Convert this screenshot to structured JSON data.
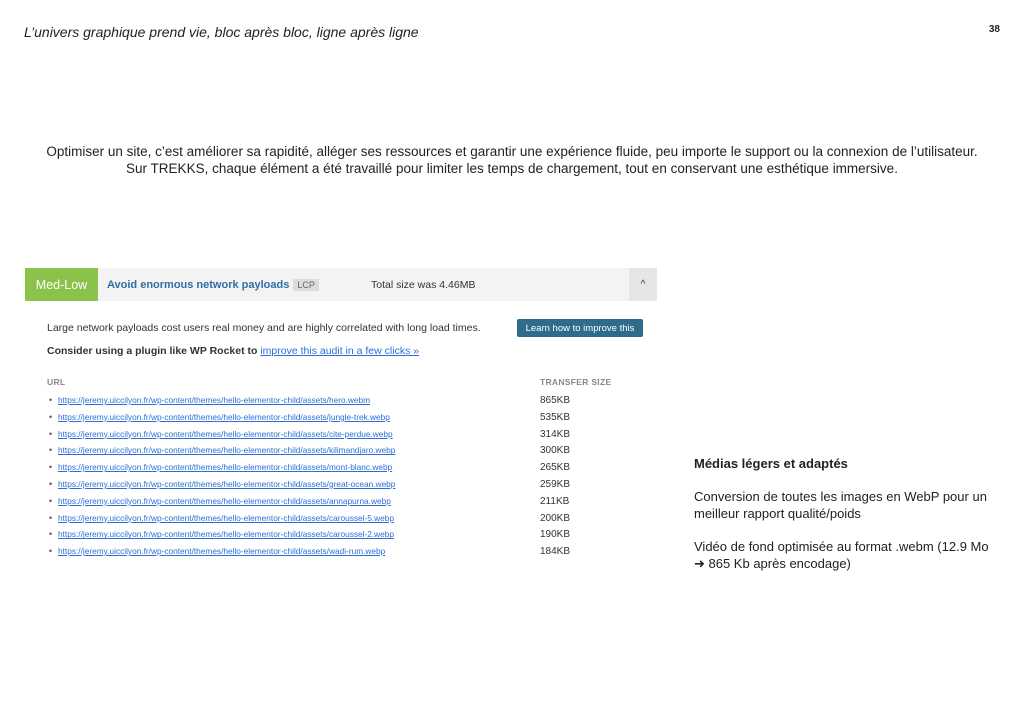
{
  "header": {
    "title": "L’univers graphique prend vie, bloc après bloc, ligne après ligne",
    "page_number": "38"
  },
  "intro": {
    "line1": "Optimiser un site, c’est améliorer sa rapidité, alléger ses ressources et garantir une expérience fluide, peu importe le support ou la connexion de l’utilisateur.",
    "line2": "Sur TREKKS, chaque élément a été travaillé pour limiter les temps de chargement, tout en conservant une esthétique immersive."
  },
  "audit": {
    "severity": "Med-Low",
    "title": "Avoid enormous network payloads",
    "tag": "LCP",
    "total_size": "Total size was 4.46MB",
    "toggle_icon": "chevron-up-icon",
    "toggle_glyph": "^",
    "description": "Large network payloads cost users real money and are highly correlated with long load times.",
    "learn_button": "Learn how to improve this",
    "plugin_prefix": "Consider using a plugin like WP Rocket to",
    "plugin_link": "improve this audit in a few clicks »",
    "col_url": "URL",
    "col_size": "TRANSFER SIZE",
    "bullet": "•",
    "rows": [
      {
        "url": "https://jeremy.uiccilyon.fr/wp-content/themes/hello-elementor-child/assets/hero.webm",
        "size": "865KB"
      },
      {
        "url": "https://jeremy.uiccilyon.fr/wp-content/themes/hello-elementor-child/assets/jungle-trek.webp",
        "size": "535KB"
      },
      {
        "url": "https://jeremy.uiccilyon.fr/wp-content/themes/hello-elementor-child/assets/cite-perdue.webp",
        "size": "314KB"
      },
      {
        "url": "https://jeremy.uiccilyon.fr/wp-content/themes/hello-elementor-child/assets/kilimandjaro.webp",
        "size": "300KB"
      },
      {
        "url": "https://jeremy.uiccilyon.fr/wp-content/themes/hello-elementor-child/assets/mont-blanc.webp",
        "size": "265KB"
      },
      {
        "url": "https://jeremy.uiccilyon.fr/wp-content/themes/hello-elementor-child/assets/great-ocean.webp",
        "size": "259KB"
      },
      {
        "url": "https://jeremy.uiccilyon.fr/wp-content/themes/hello-elementor-child/assets/annapurna.webp",
        "size": "211KB"
      },
      {
        "url": "https://jeremy.uiccilyon.fr/wp-content/themes/hello-elementor-child/assets/caroussel-5.webp",
        "size": "200KB"
      },
      {
        "url": "https://jeremy.uiccilyon.fr/wp-content/themes/hello-elementor-child/assets/caroussel-2.webp",
        "size": "190KB"
      },
      {
        "url": "https://jeremy.uiccilyon.fr/wp-content/themes/hello-elementor-child/assets/wadi-rum.webp",
        "size": "184KB"
      }
    ]
  },
  "side": {
    "heading": "Médias légers et adaptés",
    "p1": "Conversion de toutes les images en WebP pour un meilleur rapport qualité/poids",
    "p2": "Vidéo de fond optimisée au format .webm (12.9 Mo ➜ 865 Kb après encodage)"
  },
  "colors": {
    "severity_bg": "#8bc34a",
    "title_blue": "#2f6ea6",
    "button_bg": "#2f6b8a",
    "link_blue": "#2a6fd6"
  }
}
